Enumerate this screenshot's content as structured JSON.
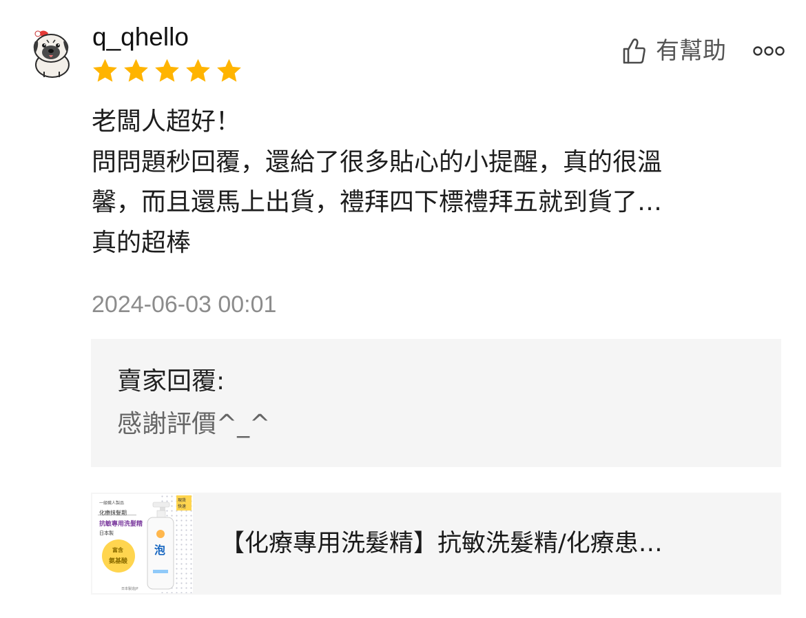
{
  "review": {
    "username": "q_qhello",
    "rating": 5,
    "rating_max": 5,
    "helpful_label": "有幫助",
    "body_lines": [
      "老闆人超好！",
      "問問題秒回覆，還給了很多貼心的小提醒，真的很溫",
      "馨，而且還馬上出貨，禮拜四下標禮拜五就到貨了…",
      "真的超棒"
    ],
    "timestamp": "2024-06-03 00:01"
  },
  "seller_reply": {
    "title": "賣家回覆:",
    "text": "感謝評價^_^"
  },
  "product": {
    "title": "【化療專用洗髮精】抗敏洗髮精/化療患…",
    "thumbnail": {
      "brand_line": "一級職人製品",
      "line1": "化療抹髮期",
      "line2": "抗敏專用洗髮精",
      "origin": "日本製",
      "badge_line1": "富含",
      "badge_line2": "氨基酸",
      "corner_line1": "現貨",
      "corner_line2": "快速",
      "bottle_char": "泡",
      "footer": "日本製造JP"
    }
  },
  "icons": {
    "avatar": "pug-avatar-icon",
    "star": "star-icon",
    "thumb": "thumbs-up-icon",
    "more": "more-options-icon"
  },
  "colors": {
    "star": "#FFB400",
    "muted_text": "#8c8c8c",
    "panel_bg": "#f5f5f5"
  }
}
